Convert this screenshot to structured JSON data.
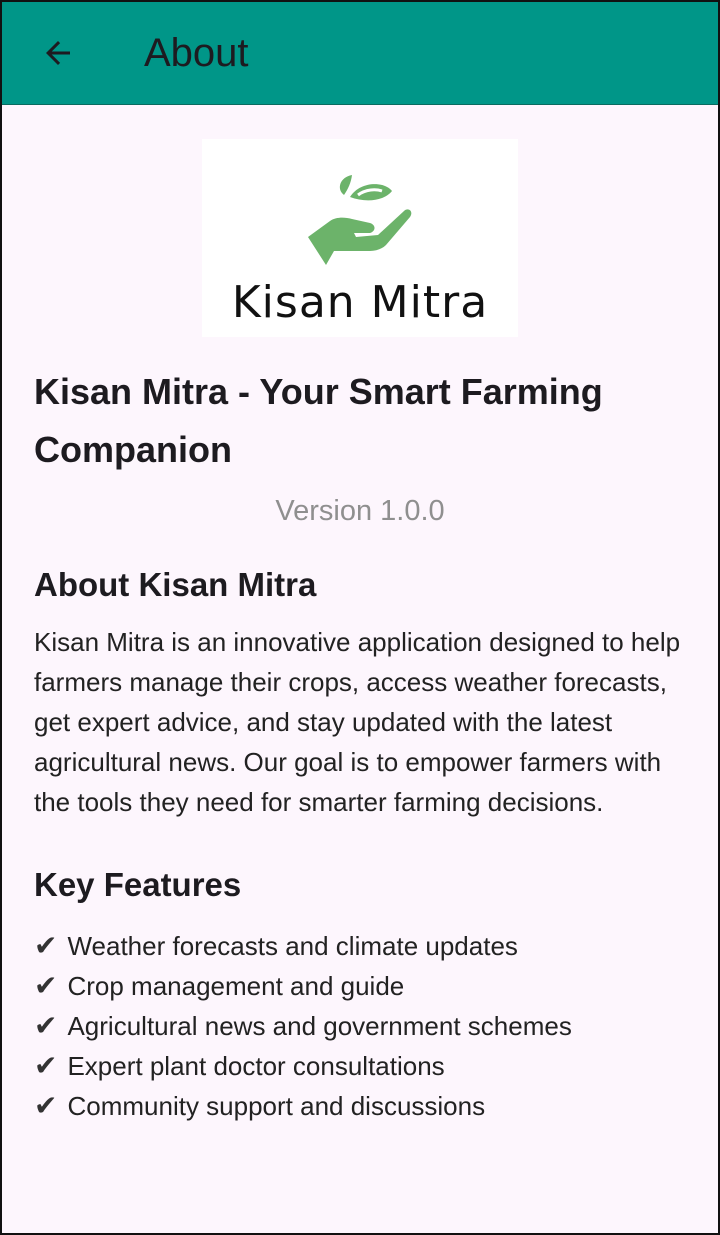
{
  "app_bar": {
    "title": "About",
    "color": "#009688"
  },
  "logo": {
    "text": "Kisan Mitra",
    "accent": "#6cb36a"
  },
  "header": {
    "app_title": "Kisan Mitra - Your Smart Farming Companion",
    "version": "Version 1.0.0"
  },
  "about": {
    "heading": "About Kisan Mitra",
    "body": "Kisan Mitra is an innovative application designed to help farmers manage their crops, access weather forecasts, get expert advice, and stay updated with the latest agricultural news. Our goal is to empower farmers with the tools they need for smarter farming decisions."
  },
  "features": {
    "heading": "Key Features",
    "check_glyph": "✔",
    "items": [
      {
        "label": "Weather forecasts and climate updates"
      },
      {
        "label": "Crop management and guide"
      },
      {
        "label": "Agricultural news and government schemes"
      },
      {
        "label": "Expert plant doctor consultations"
      },
      {
        "label": "Community support and discussions"
      }
    ]
  }
}
